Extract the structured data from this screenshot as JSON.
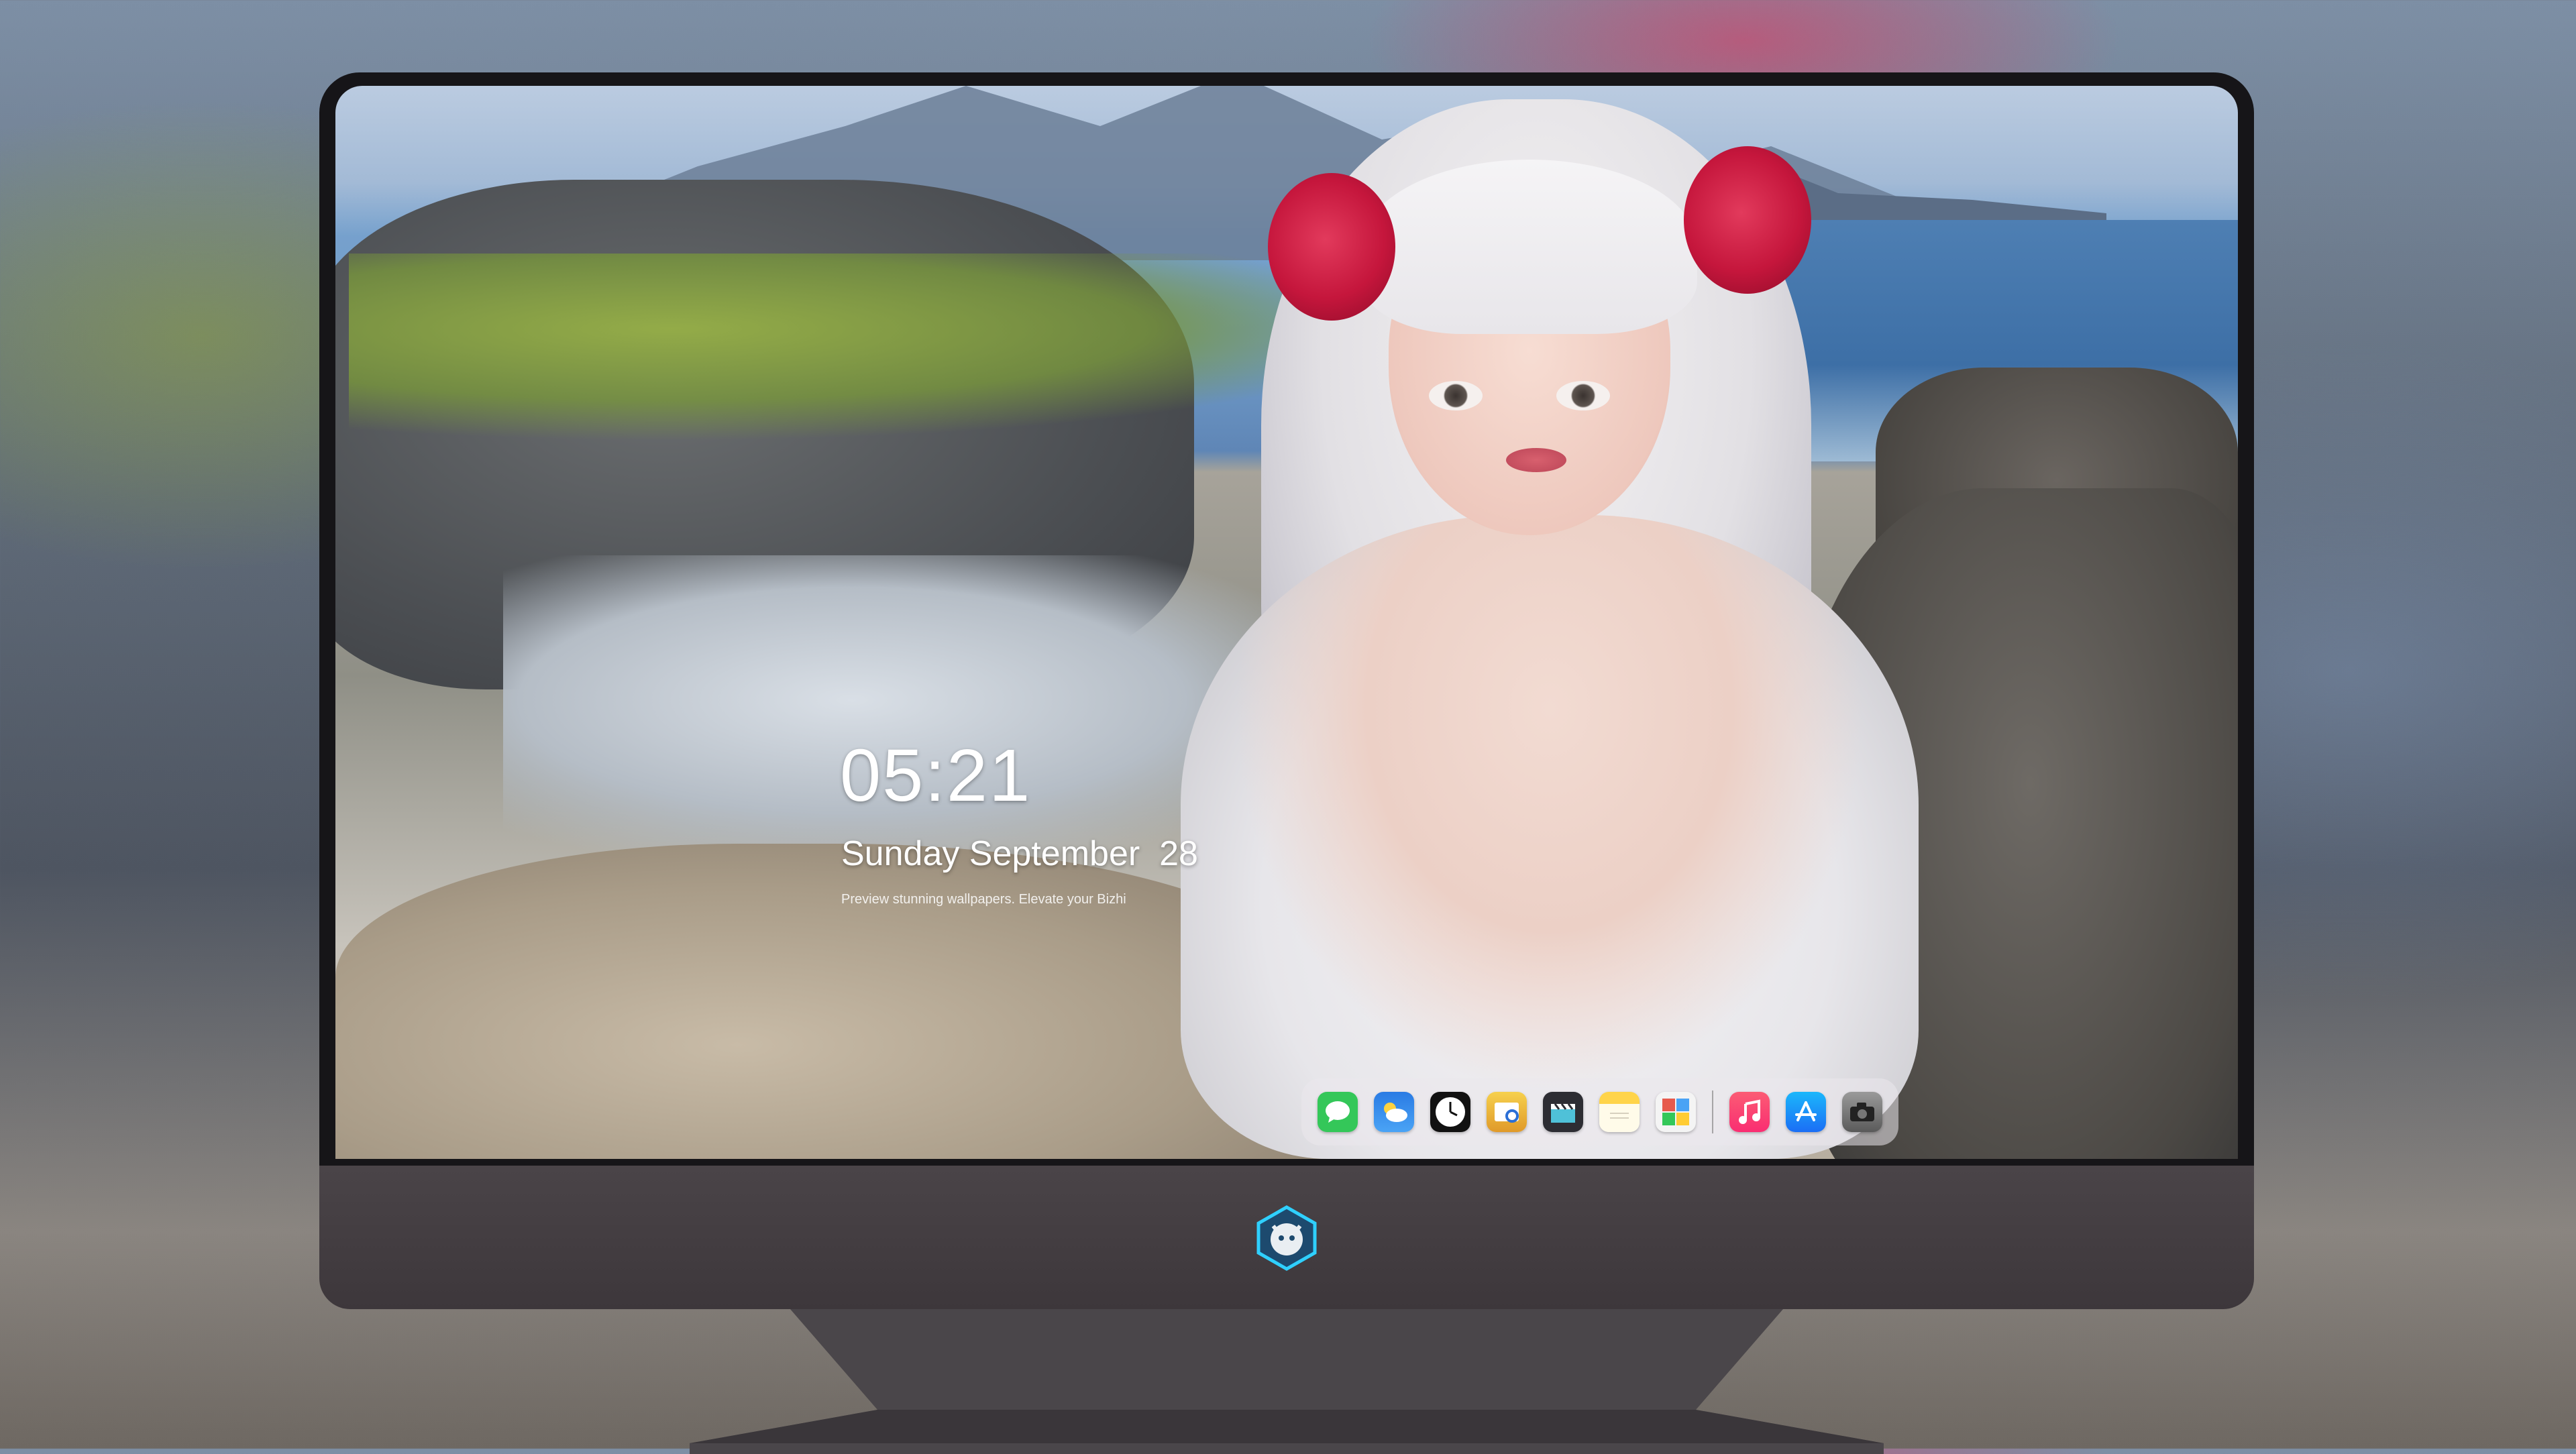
{
  "lockscreen": {
    "time": "05:21",
    "date": "Sunday September  28",
    "tagline": "Preview stunning wallpapers. Elevate your                          Bizhi"
  },
  "dock": {
    "apps": [
      {
        "name": "Messages",
        "icon": "messages-icon",
        "color": "#34c759"
      },
      {
        "name": "Weather",
        "icon": "weather-icon",
        "color": "#2f8cf0"
      },
      {
        "name": "Clock",
        "icon": "clock-icon",
        "color": "#ffffff"
      },
      {
        "name": "Preview",
        "icon": "preview-icon",
        "color": "#f2b233"
      },
      {
        "name": "Final Cut",
        "icon": "clapper-icon",
        "color": "#4fc1d8"
      },
      {
        "name": "Notes",
        "icon": "notes-icon",
        "color": "#ffd44a"
      },
      {
        "name": "Photo Booth",
        "icon": "photo-booth-icon",
        "color": "#e75a4d"
      },
      {
        "name": "Music",
        "icon": "music-icon",
        "color": "#fa2d72"
      },
      {
        "name": "App Store",
        "icon": "app-store-icon",
        "color": "#1b8cf5"
      },
      {
        "name": "Camera",
        "icon": "camera-icon",
        "color": "#6a6a6a"
      }
    ]
  },
  "monitor": {
    "logo_icon": "mascot-logo-icon",
    "bezel_color": "#161518",
    "chin_color": "#443e42"
  }
}
